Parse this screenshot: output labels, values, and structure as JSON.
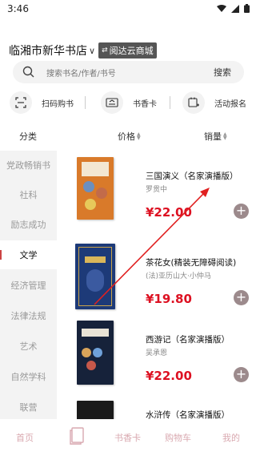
{
  "status_bar": {
    "time": "3:46"
  },
  "header": {
    "store_name": "临湘市新华书店",
    "platform_badge": "阅达云商城"
  },
  "search": {
    "placeholder": "搜索书名/作者/书号",
    "button_label": "搜索"
  },
  "quick_actions": [
    {
      "label": "扫码购书",
      "icon": "scan-icon"
    },
    {
      "label": "书香卡",
      "icon": "card-icon"
    },
    {
      "label": "活动报名",
      "icon": "calendar-add-icon"
    }
  ],
  "sort_bar": {
    "category_label": "分类",
    "price_label": "价格",
    "sales_label": "销量"
  },
  "categories": [
    {
      "label": "党政畅销书",
      "active": false
    },
    {
      "label": "社科",
      "active": false
    },
    {
      "label": "励志成功",
      "active": false
    },
    {
      "label": "文学",
      "active": true
    },
    {
      "label": "经济管理",
      "active": false
    },
    {
      "label": "法律法规",
      "active": false
    },
    {
      "label": "艺术",
      "active": false
    },
    {
      "label": "自然学科",
      "active": false
    },
    {
      "label": "联营",
      "active": false
    }
  ],
  "books": [
    {
      "title": "三国演义（名家演播版）",
      "author": "罗贯中",
      "price": "¥22.00",
      "cover_color": "#d97a2a"
    },
    {
      "title": "茶花女(精装无障碍阅读)",
      "author": "(法)亚历山大·小仲马",
      "price": "¥19.80",
      "cover_color": "#1d3a78"
    },
    {
      "title": "西游记（名家演播版）",
      "author": "吴承恩",
      "price": "¥22.00",
      "cover_color": "#16223a"
    },
    {
      "title": "水浒传（名家演播版）",
      "author": "",
      "price": "",
      "cover_color": "#1a1a1a"
    }
  ],
  "bottom_nav": [
    {
      "label": "首页"
    },
    {
      "label": "书香卡"
    },
    {
      "label": "购物车"
    },
    {
      "label": "我的"
    }
  ],
  "colors": {
    "price_red": "#d12222",
    "annotation_red": "#e02020",
    "nav_pink": "#d9a9b0"
  }
}
